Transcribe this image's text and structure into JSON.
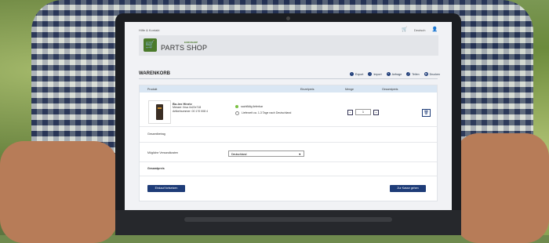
{
  "topbar": {
    "left_label": "Hilfe & Kontakt",
    "language": "Deutsch"
  },
  "header": {
    "logo_text": "PARTS SHOP",
    "logo_brand": "EUROSHOP"
  },
  "page": {
    "title": "WARENKORB",
    "actions": [
      "Export",
      "Import",
      "Anfrage",
      "Teilen",
      "Drucken"
    ]
  },
  "table": {
    "headers": [
      "Produkt",
      "Einzelpreis",
      "Menge",
      "Gesamtpreis"
    ],
    "item": {
      "name": "Bo-lex Hinriv",
      "line2": "Messer: ihsa 4n22x718",
      "line3": "Artikelnummer: 00 1?0 008 4",
      "availability": "sachflälig lieferbar",
      "delivery": "Lieferzeit ca. 1-3 Tage nach Deutschland",
      "quantity": "1"
    }
  },
  "summary": {
    "subtotal_label": "Gesamtbetrag",
    "shipping_label": "Mögliche Versandkosten",
    "shipping_selected": "Deutschland",
    "total_label": "Gesamtpreis"
  },
  "buttons": {
    "continue": "Einkauf fortsetzen",
    "checkout": "Zur Kasse gehen"
  },
  "icons": [
    "cart-icon",
    "user-icon",
    "export-icon",
    "import-icon",
    "request-icon",
    "share-icon",
    "print-icon",
    "trash-icon"
  ],
  "colors": {
    "accent": "#1e3c78",
    "brand": "#4a7a2a",
    "available": "#7bc043",
    "table_head": "#d9e6f3"
  }
}
